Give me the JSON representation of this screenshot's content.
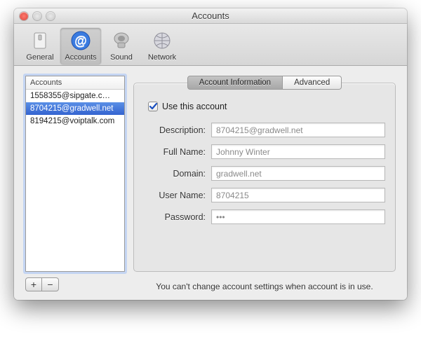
{
  "window_title": "Accounts",
  "toolbar": [
    {
      "name": "general",
      "label": "General",
      "selected": false,
      "iconColor": "#d7d7d7"
    },
    {
      "name": "accounts",
      "label": "Accounts",
      "selected": true,
      "iconColor": "#2f74d0"
    },
    {
      "name": "sound",
      "label": "Sound",
      "selected": false,
      "iconColor": "#b9b9b9"
    },
    {
      "name": "network",
      "label": "Network",
      "selected": false,
      "iconColor": "#c9c9cf"
    }
  ],
  "sidebar": {
    "header": "Accounts",
    "items": [
      {
        "label": "1558355@sipgate.c…",
        "selected": false
      },
      {
        "label": "8704215@gradwell.net",
        "selected": true
      },
      {
        "label": "8194215@voiptalk.com",
        "selected": false
      }
    ],
    "add_label": "+",
    "remove_label": "−"
  },
  "tabs": [
    {
      "key": "info",
      "label": "Account Information",
      "active": true
    },
    {
      "key": "advanced",
      "label": "Advanced",
      "active": false
    }
  ],
  "form": {
    "use_account_label": "Use this account",
    "use_account_checked": true,
    "fields": [
      {
        "key": "description",
        "label": "Description:",
        "value": "8704215@gradwell.net"
      },
      {
        "key": "full_name",
        "label": "Full Name:",
        "value": "Johnny Winter"
      },
      {
        "key": "domain",
        "label": "Domain:",
        "value": "gradwell.net"
      },
      {
        "key": "user_name",
        "label": "User Name:",
        "value": "8704215"
      },
      {
        "key": "password",
        "label": "Password:",
        "value": "•••"
      }
    ]
  },
  "footnote": "You can't change account settings when account is in use."
}
